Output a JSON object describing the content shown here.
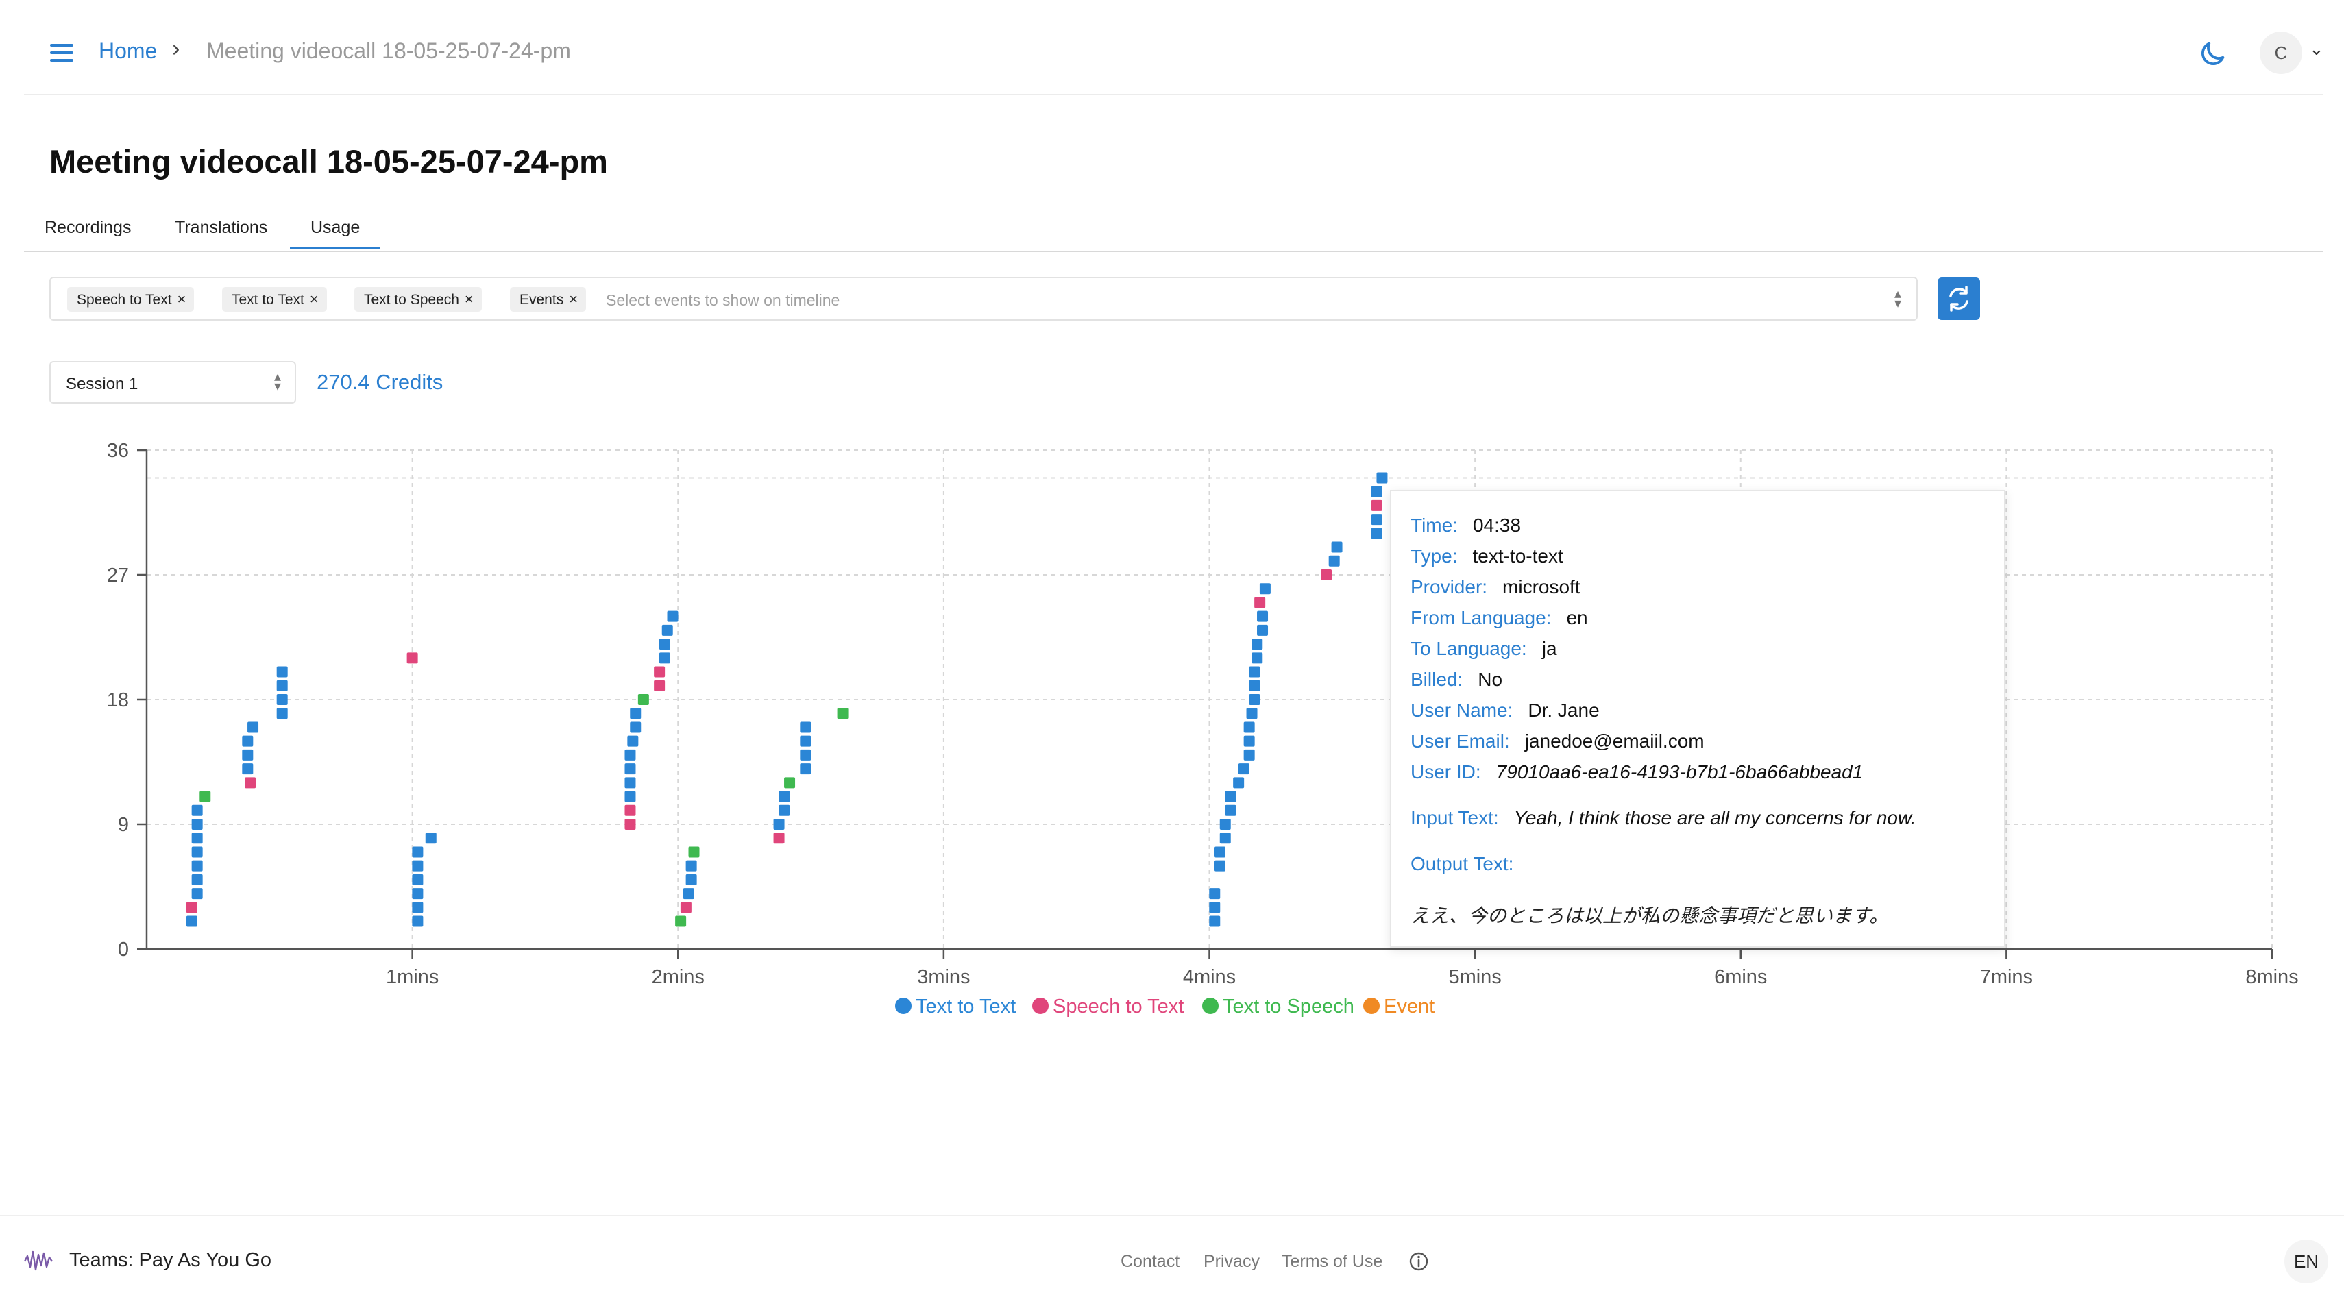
{
  "header": {
    "breadcrumb_home": "Home",
    "breadcrumb_separator": "›",
    "breadcrumb_current": "Meeting videocall 18-05-25-07-24-pm",
    "avatar_initial": "C",
    "avatar_chevron": "⌄"
  },
  "page": {
    "title": "Meeting videocall 18-05-25-07-24-pm"
  },
  "tabs": [
    {
      "label": "Recordings",
      "active": false
    },
    {
      "label": "Translations",
      "active": false
    },
    {
      "label": "Usage",
      "active": true
    }
  ],
  "filter": {
    "chips": [
      {
        "label": "Speech to Text"
      },
      {
        "label": "Text to Text"
      },
      {
        "label": "Text to Speech"
      },
      {
        "label": "Events"
      }
    ],
    "placeholder": "Select events to show on timeline",
    "chip_remove_glyph": "×"
  },
  "session": {
    "selected": "Session 1"
  },
  "credits": "270.4 Credits",
  "colors": {
    "text_to_text": "#2b86d6",
    "speech_to_text": "#e0457b",
    "text_to_speech": "#3fb950",
    "event": "#f08a24",
    "accent": "#2b7fd0"
  },
  "chart_data": {
    "type": "scatter",
    "x_unit": "mins",
    "xlim": [
      0,
      8
    ],
    "ylim": [
      0,
      36
    ],
    "y_ticks": [
      "0",
      "9",
      "18",
      "27",
      "36"
    ],
    "x_ticks": [
      "1mins",
      "2mins",
      "3mins",
      "4mins",
      "5mins",
      "6mins",
      "7mins",
      "8mins"
    ],
    "grid": true,
    "legend_position": "bottom-center",
    "series": [
      {
        "name": "Text to Text",
        "key": "text_to_text",
        "points": [
          [
            0.17,
            2
          ],
          [
            0.19,
            4
          ],
          [
            0.19,
            5
          ],
          [
            0.19,
            6
          ],
          [
            0.19,
            7
          ],
          [
            0.19,
            8
          ],
          [
            0.19,
            9
          ],
          [
            0.19,
            10
          ],
          [
            0.38,
            13
          ],
          [
            0.38,
            14
          ],
          [
            0.38,
            15
          ],
          [
            0.4,
            16
          ],
          [
            0.51,
            17
          ],
          [
            0.51,
            18
          ],
          [
            0.51,
            19
          ],
          [
            0.51,
            20
          ],
          [
            1.02,
            2
          ],
          [
            1.02,
            3
          ],
          [
            1.02,
            4
          ],
          [
            1.02,
            5
          ],
          [
            1.02,
            6
          ],
          [
            1.02,
            7
          ],
          [
            1.07,
            8
          ],
          [
            1.82,
            11
          ],
          [
            1.82,
            12
          ],
          [
            1.82,
            13
          ],
          [
            1.82,
            14
          ],
          [
            1.83,
            15
          ],
          [
            1.84,
            16
          ],
          [
            1.84,
            17
          ],
          [
            1.95,
            21
          ],
          [
            1.95,
            22
          ],
          [
            1.96,
            23
          ],
          [
            1.98,
            24
          ],
          [
            2.04,
            4
          ],
          [
            2.05,
            5
          ],
          [
            2.05,
            6
          ],
          [
            2.38,
            9
          ],
          [
            2.4,
            10
          ],
          [
            2.4,
            11
          ],
          [
            2.48,
            13
          ],
          [
            2.48,
            14
          ],
          [
            2.48,
            15
          ],
          [
            2.48,
            16
          ],
          [
            4.02,
            2
          ],
          [
            4.02,
            3
          ],
          [
            4.02,
            4
          ],
          [
            4.04,
            6
          ],
          [
            4.04,
            7
          ],
          [
            4.06,
            8
          ],
          [
            4.06,
            9
          ],
          [
            4.08,
            10
          ],
          [
            4.08,
            11
          ],
          [
            4.11,
            12
          ],
          [
            4.13,
            13
          ],
          [
            4.15,
            14
          ],
          [
            4.15,
            15
          ],
          [
            4.15,
            16
          ],
          [
            4.16,
            17
          ],
          [
            4.17,
            18
          ],
          [
            4.17,
            19
          ],
          [
            4.17,
            20
          ],
          [
            4.18,
            21
          ],
          [
            4.18,
            22
          ],
          [
            4.2,
            23
          ],
          [
            4.2,
            24
          ],
          [
            4.21,
            26
          ],
          [
            4.47,
            28
          ],
          [
            4.48,
            29
          ],
          [
            4.63,
            30
          ],
          [
            4.63,
            31
          ],
          [
            4.63,
            33
          ],
          [
            4.65,
            34
          ]
        ]
      },
      {
        "name": "Speech to Text",
        "key": "speech_to_text",
        "points": [
          [
            0.17,
            3
          ],
          [
            0.39,
            12
          ],
          [
            1.0,
            21
          ],
          [
            1.82,
            9
          ],
          [
            1.82,
            10
          ],
          [
            1.93,
            19
          ],
          [
            1.93,
            20
          ],
          [
            2.03,
            3
          ],
          [
            2.38,
            8
          ],
          [
            4.19,
            25
          ],
          [
            4.44,
            27
          ],
          [
            4.63,
            32
          ]
        ]
      },
      {
        "name": "Text to Speech",
        "key": "text_to_speech",
        "points": [
          [
            0.22,
            11
          ],
          [
            1.87,
            18
          ],
          [
            2.01,
            2
          ],
          [
            2.06,
            7
          ],
          [
            2.42,
            12
          ],
          [
            2.62,
            17
          ]
        ]
      },
      {
        "name": "Event",
        "key": "event",
        "points": []
      }
    ]
  },
  "tooltip": {
    "rows": [
      {
        "key": "Time:",
        "value": "04:38",
        "italic": false
      },
      {
        "key": "Type:",
        "value": "text-to-text",
        "italic": false
      },
      {
        "key": "Provider:",
        "value": "microsoft",
        "italic": false
      },
      {
        "key": "From Language:",
        "value": "en",
        "italic": false
      },
      {
        "key": "To Language:",
        "value": "ja",
        "italic": false
      },
      {
        "key": "Billed:",
        "value": "No",
        "italic": false
      },
      {
        "key": "User Name:",
        "value": "Dr. Jane",
        "italic": false
      },
      {
        "key": "User Email:",
        "value": "janedoe@emaiil.com",
        "italic": false
      },
      {
        "key": "User ID:",
        "value": "79010aa6-ea16-4193-b7b1-6ba66abbead1",
        "italic": true
      },
      {
        "key": "Input Text:",
        "value": "Yeah, I think those are all my concerns for now.",
        "italic": true
      },
      {
        "key": "Output Text:",
        "value": "",
        "italic": false
      }
    ],
    "output_text": "ええ、今のところは以上が私の懸念事項だと思います。"
  },
  "footer": {
    "brand": "Teams: Pay As You Go",
    "links": [
      "Contact",
      "Privacy",
      "Terms of Use"
    ],
    "language": "EN"
  }
}
